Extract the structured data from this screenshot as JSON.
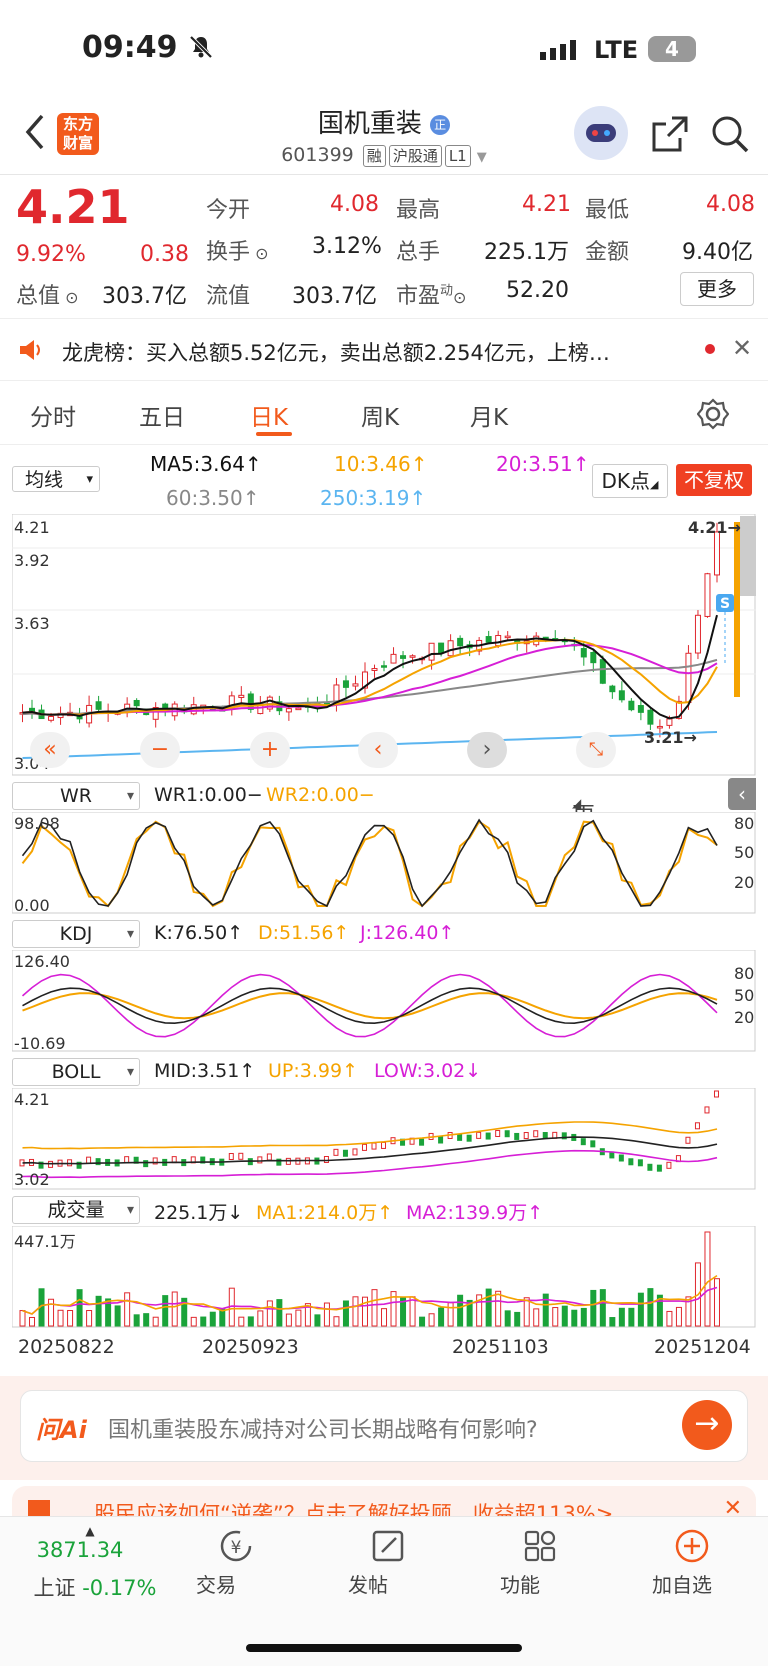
{
  "status_bar": {
    "time": "09:49",
    "network": "LTE",
    "battery": "4"
  },
  "header": {
    "logo_line1": "东方",
    "logo_line2": "财富",
    "stock_name": "国机重装",
    "stock_code": "601399",
    "tags": [
      "融",
      "沪股通",
      "L1"
    ]
  },
  "quote": {
    "price": "4.21",
    "change_pct": "9.92%",
    "change": "0.38",
    "open_label": "今开",
    "open": "4.08",
    "high_label": "最高",
    "high": "4.21",
    "low_label": "最低",
    "low": "4.08",
    "turnover_label": "换手",
    "turnover": "3.12%",
    "volume_label": "总手",
    "volume": "225.1万",
    "amount_label": "金额",
    "amount": "9.40亿",
    "total_cap_label": "总值",
    "total_cap": "303.7亿",
    "float_cap_label": "流值",
    "float_cap": "303.7亿",
    "pe_label": "市盈",
    "pe_sup": "动",
    "pe": "52.20",
    "more_label": "更多"
  },
  "notice": {
    "text": "龙虎榜：买入总额5.52亿元，卖出总额2.254亿元，上榜…"
  },
  "tabs": [
    "分时",
    "五日",
    "日K",
    "周K",
    "月K",
    "更多"
  ],
  "active_tab": "日K",
  "ma": {
    "selector": "均线",
    "ma5": "MA5:3.64↑",
    "ma10": "10:3.46↑",
    "ma20": "20:3.51↑",
    "ma60": "60:3.50↑",
    "ma250": "250:3.19↑",
    "dk_label": "DK点",
    "fq_label": "不复权"
  },
  "kline": {
    "axis_top": "4.21",
    "axis_2": "3.92",
    "axis_3": "3.63",
    "axis_bottom": "3.04",
    "last_price_label": "4.21→",
    "low_marker": "3.21→",
    "signal": "S"
  },
  "wr": {
    "label": "WR",
    "wr1": "WR1:0.00−",
    "wr2": "WR2:0.00−",
    "axis_top": "98.08",
    "axis_bottom": "0.00",
    "l80": "80",
    "l50": "50",
    "l20": "20"
  },
  "kdj": {
    "label": "KDJ",
    "k": "K:76.50↑",
    "d": "D:51.56↑",
    "j": "J:126.40↑",
    "axis_top": "126.40",
    "axis_bottom": "-10.69",
    "l80": "80",
    "l50": "50",
    "l20": "20"
  },
  "boll": {
    "label": "BOLL",
    "mid": "MID:3.51↑",
    "up": "UP:3.99↑",
    "low": "LOW:3.02↓",
    "axis_top": "4.21",
    "axis_bottom": "3.02"
  },
  "volume": {
    "label": "成交量",
    "vol": "225.1万↓",
    "ma1": "MA1:214.0万↑",
    "ma2": "MA2:139.9万↑",
    "axis_top": "447.1万"
  },
  "dates": [
    "20250822",
    "20250923",
    "20251103",
    "20251204"
  ],
  "ai": {
    "logo": "问Ai",
    "prompt": "国机重装股东减持对公司长期战略有何影响?"
  },
  "promo": {
    "text": "股民应该如何“逆袭”？点击了解好投顾，收益超113%>"
  },
  "bottom_nav": {
    "index_value": "3871.34",
    "index_name": "上证",
    "index_change": "-0.17%",
    "trade": "交易",
    "post": "发帖",
    "func": "功能",
    "add": "加自选"
  },
  "colors": {
    "up": "#e0282e",
    "down": "#1aa33a",
    "ma5": "#111111",
    "ma10": "#f5a300",
    "ma20": "#d61fd6",
    "ma60": "#888888",
    "ma250": "#5bb5f0",
    "accent": "#f25a1c"
  },
  "chart_data": {
    "type": "candlestick",
    "ohlc_recent": [
      {
        "o": 3.25,
        "h": 3.28,
        "l": 3.21,
        "c": 3.23
      },
      {
        "o": 3.24,
        "h": 3.35,
        "l": 3.22,
        "c": 3.33
      },
      {
        "o": 3.33,
        "h": 3.58,
        "l": 3.3,
        "c": 3.5
      },
      {
        "o": 3.5,
        "h": 3.85,
        "l": 3.48,
        "c": 3.83
      },
      {
        "o": 4.08,
        "h": 4.21,
        "l": 4.08,
        "c": 4.21
      }
    ],
    "ylim": [
      3.04,
      4.21
    ]
  }
}
